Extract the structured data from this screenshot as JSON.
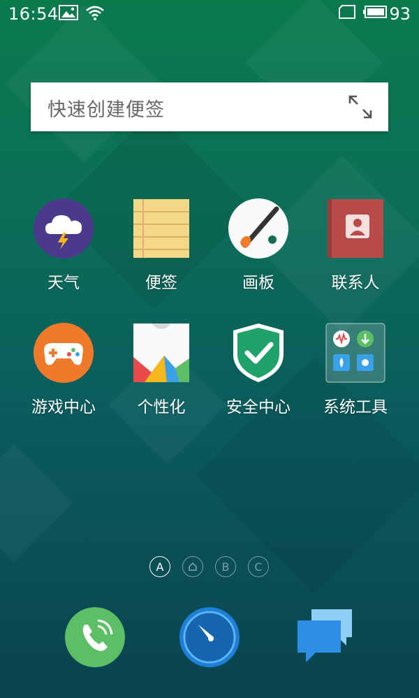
{
  "status_bar": {
    "time": "16:54",
    "battery_level": "93",
    "icons": [
      "gallery-icon",
      "wifi-icon",
      "sim-card-icon",
      "battery-icon"
    ]
  },
  "note_widget": {
    "placeholder": "快速创建便签",
    "expand_icon": "expand-icon"
  },
  "apps": [
    {
      "label": "天气",
      "icon": "weather-icon"
    },
    {
      "label": "便签",
      "icon": "notes-icon"
    },
    {
      "label": "画板",
      "icon": "palette-icon"
    },
    {
      "label": "联系人",
      "icon": "contacts-icon"
    },
    {
      "label": "游戏中心",
      "icon": "game-controller-icon"
    },
    {
      "label": "个性化",
      "icon": "theme-shirt-icon"
    },
    {
      "label": "安全中心",
      "icon": "shield-check-icon"
    },
    {
      "label": "系统工具",
      "icon": "system-tools-folder-icon"
    }
  ],
  "page_indicators": [
    {
      "label": "A",
      "active": true
    },
    {
      "label": "",
      "icon": "home-icon",
      "active": false
    },
    {
      "label": "B",
      "active": false
    },
    {
      "label": "C",
      "active": false
    }
  ],
  "dock": [
    {
      "icon": "phone-icon"
    },
    {
      "icon": "browser-compass-icon"
    },
    {
      "icon": "messages-icon"
    }
  ],
  "colors": {
    "weather_bg": "#4b3a8c",
    "notes_bg": "#f5d78a",
    "contacts_bg": "#b94a4a",
    "game_bg": "#f07a2c",
    "security_bg": "#1fa36a",
    "phone_bg": "#5cbf66",
    "browser_bg": "#1e7fd6",
    "messages_bg": "#3aa0e8"
  }
}
